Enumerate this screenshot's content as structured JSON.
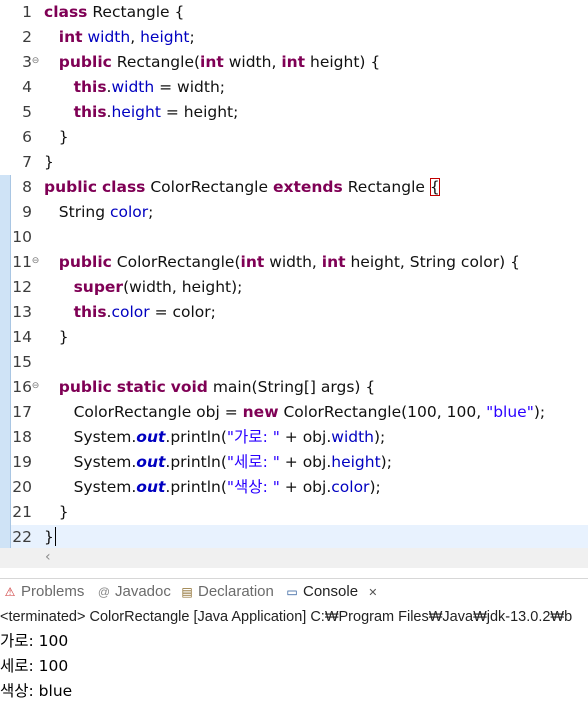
{
  "editor": {
    "lines": [
      {
        "n": "1"
      },
      {
        "n": "2"
      },
      {
        "n": "3"
      },
      {
        "n": "4"
      },
      {
        "n": "5"
      },
      {
        "n": "6"
      },
      {
        "n": "7"
      },
      {
        "n": "8"
      },
      {
        "n": "9"
      },
      {
        "n": "10"
      },
      {
        "n": "11"
      },
      {
        "n": "12"
      },
      {
        "n": "13"
      },
      {
        "n": "14"
      },
      {
        "n": "15"
      },
      {
        "n": "16"
      },
      {
        "n": "17"
      },
      {
        "n": "18"
      },
      {
        "n": "19"
      },
      {
        "n": "20"
      },
      {
        "n": "21"
      },
      {
        "n": "22"
      }
    ],
    "code": {
      "l1": [
        "class",
        "Rectangle {"
      ],
      "l2": [
        "int",
        "width",
        ", ",
        "height",
        ";"
      ],
      "l3": [
        "public",
        "Rectangle(",
        "int",
        "width, ",
        "int",
        "height) {"
      ],
      "l4": [
        "this",
        ".",
        "width",
        " = width;"
      ],
      "l5": [
        "this",
        ".",
        "height",
        " = height;"
      ],
      "l6": "}",
      "l7": "}",
      "l8": [
        "public",
        "class",
        "ColorRectangle",
        "extends",
        "Rectangle",
        "{"
      ],
      "l9": [
        "String ",
        "color",
        ";"
      ],
      "l11": [
        "public",
        "ColorRectangle(",
        "int",
        "width, ",
        "int",
        "height, String color) {"
      ],
      "l12": [
        "super",
        "(width, height);"
      ],
      "l13": [
        "this",
        ".",
        "color",
        " = color;"
      ],
      "l14": "}",
      "l16": [
        "public",
        "static",
        "void",
        "main(String[] args) {"
      ],
      "l17": [
        "ColorRectangle obj = ",
        "new",
        "ColorRectangle(100, 100, ",
        "\"blue\"",
        ");"
      ],
      "l18": [
        "System.",
        "out",
        ".println(",
        "\"가로: \"",
        " + obj.",
        "width",
        ");"
      ],
      "l19": [
        "System.",
        "out",
        ".println(",
        "\"세로: \"",
        " + obj.",
        "height",
        ");"
      ],
      "l20": [
        "System.",
        "out",
        ".println(",
        "\"색상: \"",
        " + obj.",
        "color",
        ");"
      ],
      "l21": "}",
      "l22": "}"
    }
  },
  "tabs": {
    "problems": "Problems",
    "javadoc": "Javadoc",
    "declaration": "Declaration",
    "console": "Console",
    "console_close": "✕"
  },
  "console": {
    "path": "<terminated> ColorRectangle [Java Application] C:₩Program Files₩Java₩jdk-13.0.2₩b",
    "output": [
      "가로: 100",
      "세로: 100",
      "색상: blue"
    ]
  },
  "colors": {
    "keyword": "#7f0055",
    "field": "#0000c0",
    "string": "#2a00ff",
    "current_line": "#e8f2fe"
  }
}
